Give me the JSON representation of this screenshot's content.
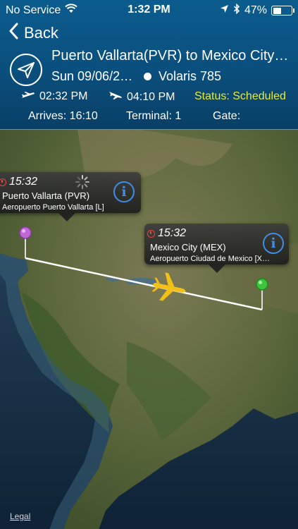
{
  "status_bar": {
    "carrier": "No Service",
    "time": "1:32 PM",
    "battery": "47%",
    "battery_level": 0.47,
    "icons": [
      "wifi-icon",
      "location-arrow-icon",
      "bluetooth-icon",
      "battery-icon"
    ]
  },
  "nav": {
    "back_label": "Back"
  },
  "flight": {
    "route": "Puerto Vallarta(PVR) to Mexico City…",
    "date": "Sun 09/06/2…",
    "flight_number": "Volaris 785",
    "departure_time": "02:32 PM",
    "arrival_time": "04:10 PM",
    "status": "Status: Scheduled",
    "arrives": "Arrives: 16:10",
    "terminal": "Terminal: 1",
    "gate": "Gate:"
  },
  "map": {
    "origin": {
      "time": "15:32",
      "name": "Puerto Vallarta (PVR)",
      "airport": "Aeropuerto Puerto Vallarta [L]",
      "pin_color": "#c069d6"
    },
    "destination": {
      "time": "15:32",
      "name": "Mexico City (MEX)",
      "airport": "Aeropuerto Ciudad de Mexico [X…",
      "pin_color": "#3cc43c"
    },
    "legal_label": "Legal"
  },
  "colors": {
    "header_bg": "#0a4f7d",
    "status_text": "#e6ea3a",
    "info_blue": "#3d8fe8",
    "plane_yellow": "#f2c017",
    "route_line": "#ffffff"
  }
}
